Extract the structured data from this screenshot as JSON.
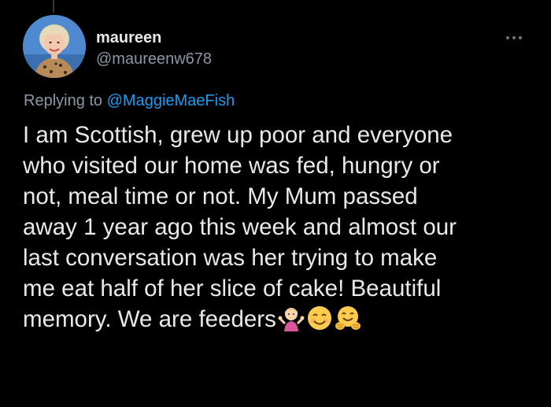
{
  "tweet": {
    "author": {
      "display_name": "maureen",
      "handle": "@maureenw678",
      "avatar": "profile-photo"
    },
    "more_icon": "ellipsis-icon",
    "replying_to": {
      "prefix": "Replying to",
      "mention": "@MaggieMaeFish"
    },
    "body_lines": [
      "I am Scottish, grew up poor and everyone",
      "who visited our home was fed, hungry or",
      "not, meal time or not. My Mum passed",
      "away 1 year ago this week and almost our",
      "last conversation was her trying to make",
      "me eat half of her slice of cake! Beautiful",
      "memory. We are feeders"
    ],
    "trailing_emojis": [
      "person-shrugging-emoji",
      "smiling-face-emoji",
      "hugging-face-emoji"
    ]
  },
  "colors": {
    "background": "#000000",
    "text_primary": "#e7e9ea",
    "text_secondary": "#8b98a5",
    "link": "#1d9bf0"
  }
}
